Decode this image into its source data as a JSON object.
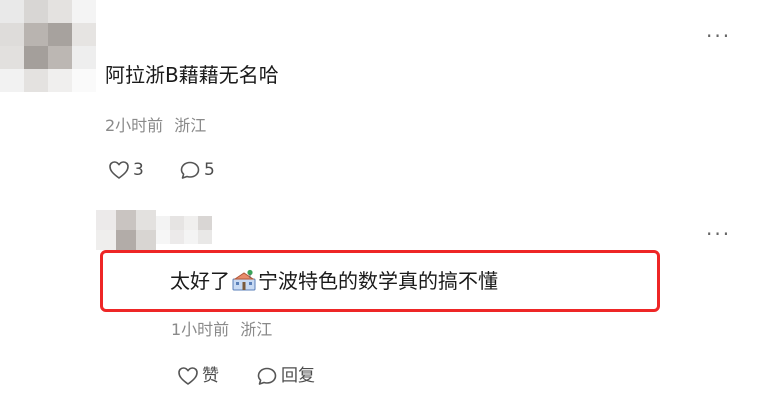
{
  "comments": [
    {
      "text": "阿拉浙B藉藉无名哈",
      "time": "2小时前",
      "location": "浙江",
      "likes": "3",
      "replies": "5",
      "more_label": "···"
    },
    {
      "text_before_emoji": "太好了",
      "emoji_name": "school-emoji",
      "text_after_emoji": "宁波特色的数学真的搞不懂",
      "time": "1小时前",
      "location": "浙江",
      "like_label": "赞",
      "reply_label": "回复",
      "more_label": "···"
    }
  ],
  "colors": {
    "highlight": "#ee2626",
    "meta_text": "#8a8a8a",
    "body_text": "#1a1a1a"
  }
}
